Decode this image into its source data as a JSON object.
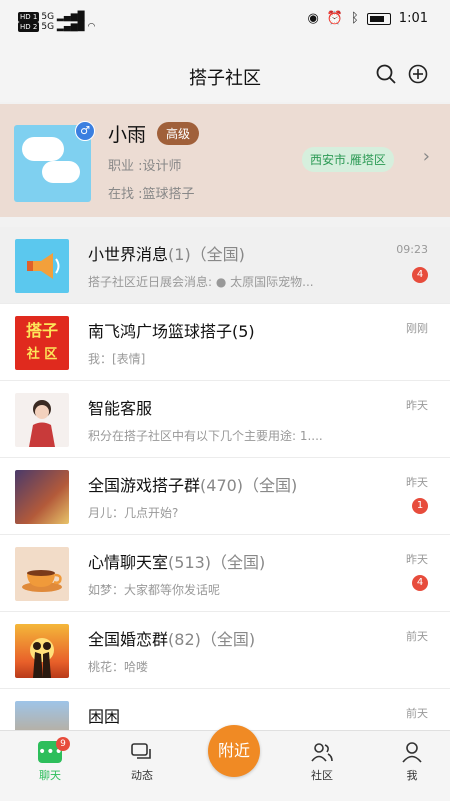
{
  "status": {
    "time": "1:01",
    "net": "5G"
  },
  "header": {
    "title": "搭子社区"
  },
  "profile": {
    "name": "小雨",
    "level": "高级",
    "job": "职业 :设计师",
    "seeking": "在找 :篮球搭子",
    "location": "西安市.雁塔区",
    "gender": "♂"
  },
  "chats": [
    {
      "name": "小世界消息",
      "sub": "(1)（全国)",
      "msg": "搭子社区近日展会消息:  ● 太原国际宠物...",
      "time": "09:23",
      "badge": "4"
    },
    {
      "name": "南飞鸿广场篮球搭子(5)",
      "sub": "",
      "msg": "我：[表情]",
      "time": "刚刚",
      "badge": ""
    },
    {
      "name": "智能客服",
      "sub": "",
      "msg": "积分在搭子社区中有以下几个主要用途:  1....",
      "time": "昨天",
      "badge": ""
    },
    {
      "name": "全国游戏搭子群",
      "sub": "(470)（全国)",
      "msg": "月儿：几点开始?",
      "time": "昨天",
      "badge": "1"
    },
    {
      "name": "心情聊天室",
      "sub": "(513)（全国)",
      "msg": "如梦：大家都等你发话呢",
      "time": "昨天",
      "badge": "4"
    },
    {
      "name": "全国婚恋群",
      "sub": "(82)（全国)",
      "msg": "桃花：哈喽",
      "time": "前天",
      "badge": ""
    },
    {
      "name": "困困",
      "sub": "",
      "msg": "",
      "time": "前天",
      "badge": ""
    }
  ],
  "avatar_text": {
    "dazi_top": "搭子",
    "dazi_bottom": "社 区"
  },
  "tabs": {
    "chat": "聊天",
    "feed": "动态",
    "nearby": "附近",
    "community": "社区",
    "me": "我",
    "chat_badge": "9"
  },
  "colors": {
    "accent": "#2dbe5b",
    "badge": "#e74c3c",
    "nearby": "#f08a24"
  }
}
